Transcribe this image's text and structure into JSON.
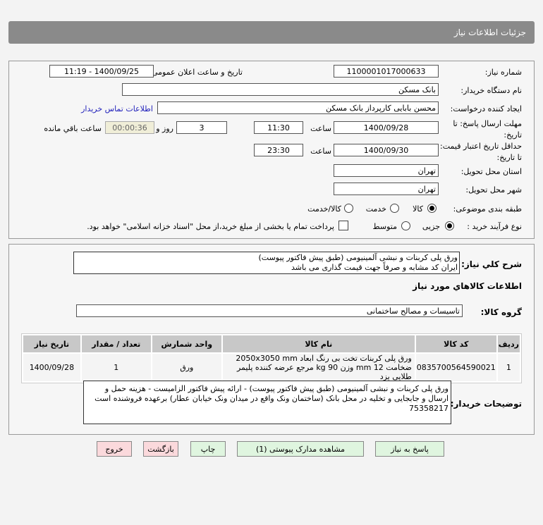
{
  "header": {
    "title": "جزئیات اطلاعات نیاز"
  },
  "form": {
    "need_number_label": "شماره نیاز:",
    "need_number": "1100001017000633",
    "announce_label": "تاریخ و ساعت اعلان عمومی:",
    "announce_value": "1400/09/25 - 11:19",
    "buyer_label": "نام دستگاه خریدار:",
    "buyer": "بانک مسکن",
    "creator_label": "ایجاد کننده درخواست:",
    "creator": "محسن بابایی کارپرداز بانک مسکن",
    "contact_link": "اطلاعات تماس خریدار",
    "deadline_label": "مهلت ارسال پاسخ: تا تاریخ:",
    "deadline_date": "1400/09/28",
    "time_label": "ساعت",
    "deadline_time": "11:30",
    "days": "3",
    "days_label": "روز و",
    "remaining": "00:00:36",
    "remaining_label": "ساعت باقي مانده",
    "validity_label": "حداقل تاریخ اعتبار قیمت: تا تاریخ:",
    "validity_date": "1400/09/30",
    "validity_time": "23:30",
    "province_label": "استان محل تحویل:",
    "province": "تهران",
    "city_label": "شهر محل تحویل:",
    "city": "تهران",
    "category_label": "طبقه بندی موضوعی:",
    "category_options": [
      "کالا",
      "خدمت",
      "کالا/خدمت"
    ],
    "category_selected": "کالا",
    "process_label": "نوع فرآیند خرید :",
    "process_options": [
      "جزیی",
      "متوسط"
    ],
    "process_selected": "جزیی",
    "treasury_text": "پرداخت تمام یا بخشی از مبلغ خرید،از محل \"اسناد خزانه اسلامی\" خواهد بود."
  },
  "details": {
    "summary_label": "شرح کلي نياز:",
    "summary_lines": [
      "ورق پلی کربنات و نبشی آلمینیومی (طبق پیش فاکتور پیوست)",
      "ایران کد مشابه و صرفاً جهت قیمت گذاری می باشد"
    ],
    "goods_title": "اطلاعات کالاهاي مورد نياز",
    "group_label": "گروه کالا:",
    "group": "تاسیسات و مصالح ساختمانی",
    "table": {
      "headers": [
        "ردیف",
        "کد کالا",
        "نام کالا",
        "واحد شمارش",
        "تعداد / مقدار",
        "تاریخ نیاز"
      ],
      "rows": [
        [
          "1",
          "0835700564590021",
          "ورق پلی کربنات تخت بی رنگ ابعاد 2050x3050 mm ضخامت 12 mm وزن 90 kg مرجع عرضه کننده پلیمر طلایی یزد",
          "ورق",
          "1",
          "1400/09/28"
        ]
      ]
    },
    "notes_label": "توضیحات خریدار:",
    "notes": "ورق پلی کربنات و نبشی آلمینیومی (طبق پیش فاکتور پیوست) - ارائه پیش فاکتور الزامیست - هزینه حمل و ارسال و جابجایی و تخلیه در محل بانک (ساختمان ونک واقع در میدان ونک خیابان عطار) برعهده فروشنده است  75358217"
  },
  "buttons": {
    "reply": "پاسخ به نیاز",
    "attachments": "مشاهده مدارک پیوستی (1)",
    "print": "چاپ",
    "back": "بازگشت",
    "exit": "خروج"
  }
}
